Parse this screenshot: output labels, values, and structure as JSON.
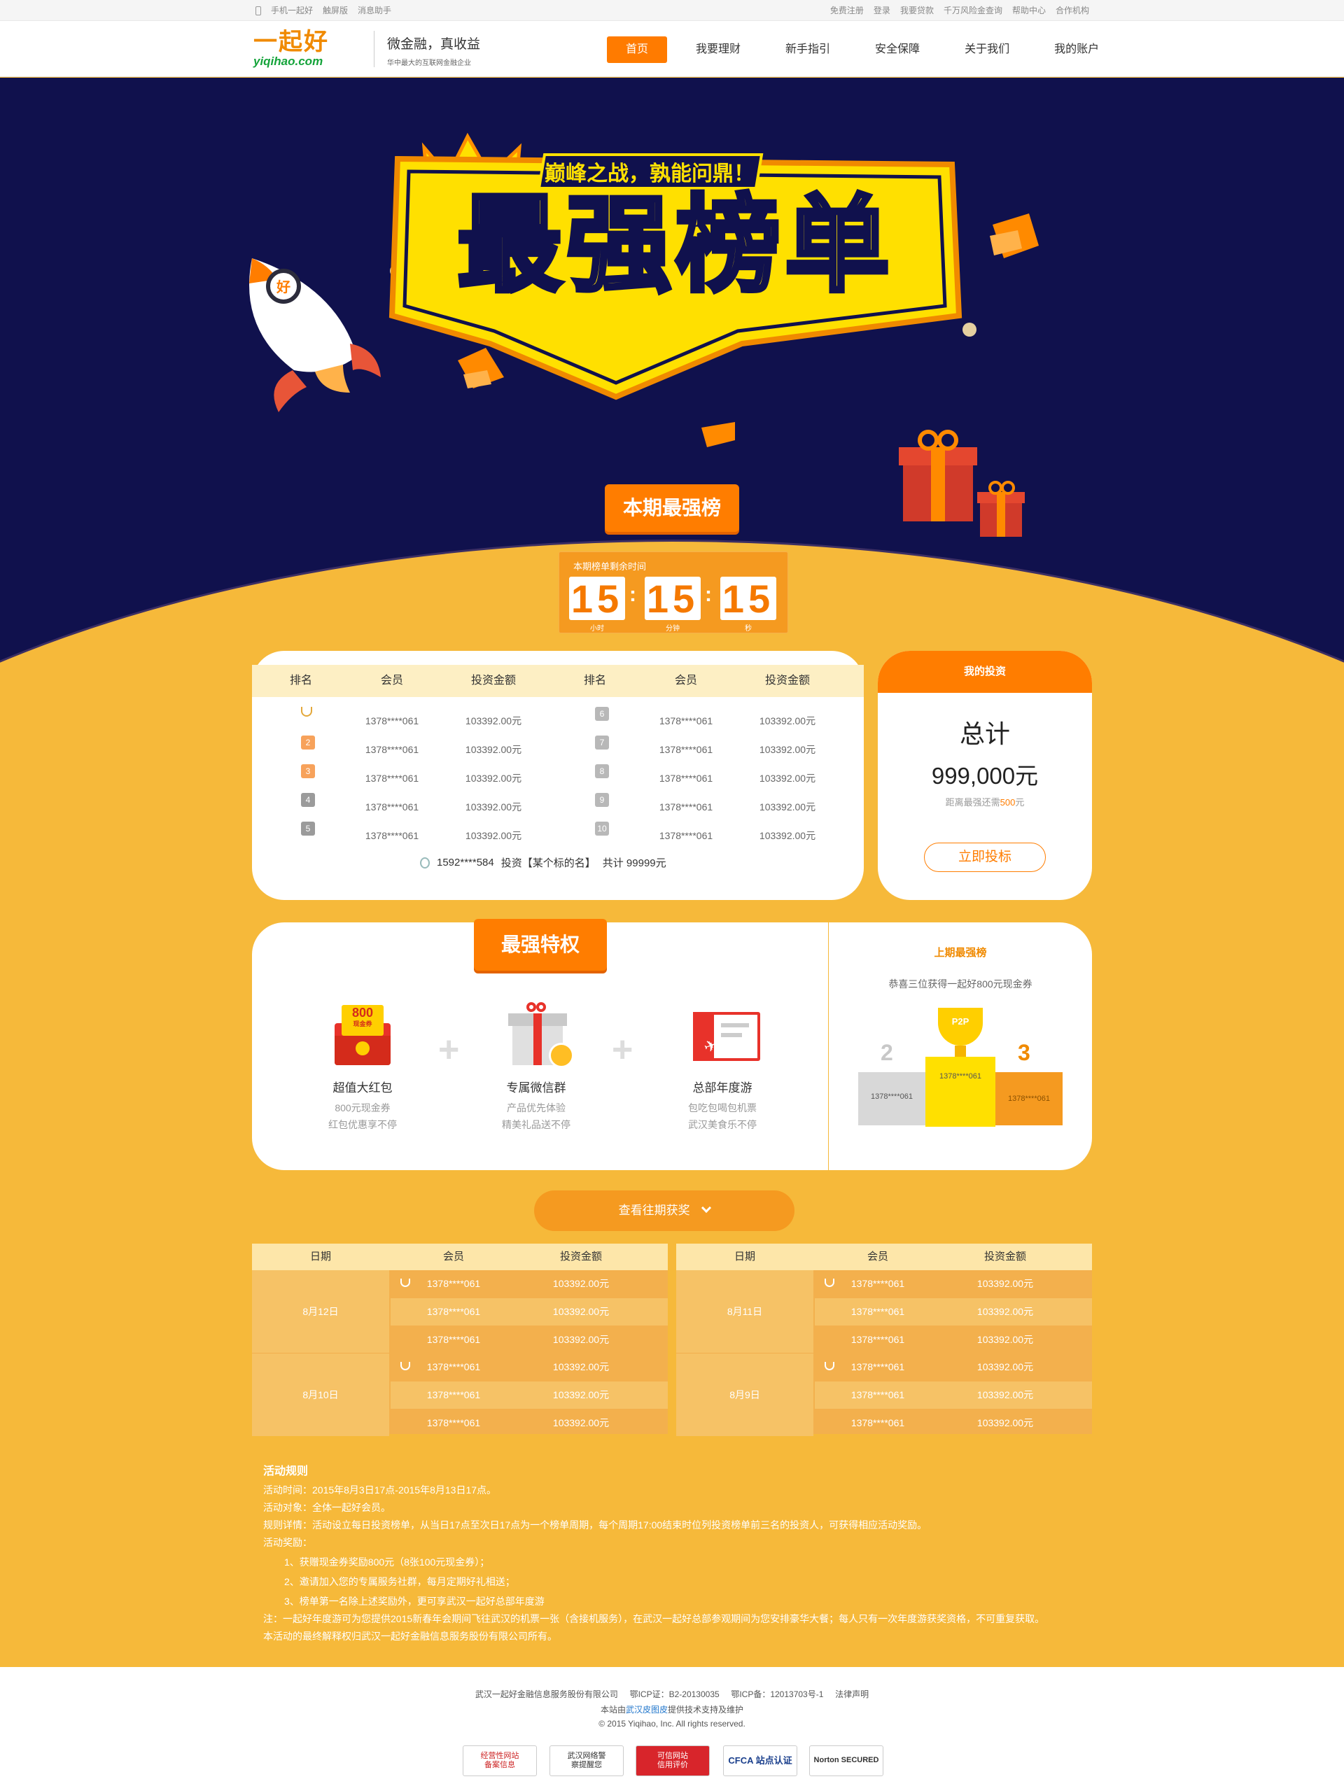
{
  "topbar": {
    "left": [
      "手机一起好",
      "触屏版",
      "消息助手"
    ],
    "right": [
      "免费注册",
      "登录",
      "我要贷款",
      "千万风险金查询",
      "帮助中心",
      "合作机构"
    ]
  },
  "header": {
    "logo_cn": "一起好",
    "logo_en": "yiqihao.com",
    "slogan1": "微金融，真收益",
    "slogan2": "华中最大的互联网金融企业",
    "nav": [
      "首页",
      "我要理财",
      "新手指引",
      "安全保障",
      "关于我们",
      "我的账户"
    ]
  },
  "hero": {
    "tagline": "巅峰之战，孰能问鼎！",
    "title": "最强榜单",
    "rocket_badge": "好"
  },
  "period": {
    "tab": "本期最强榜",
    "countdown_label": "本期榜单剩余时间",
    "hours": "15",
    "minutes": "15",
    "seconds": "15",
    "unit_h": "小时",
    "unit_m": "分钟",
    "unit_s": "秒"
  },
  "ranking": {
    "headers": [
      "排名",
      "会员",
      "投资金额",
      "排名",
      "会员",
      "投资金额"
    ],
    "left": [
      {
        "rank": "1",
        "member": "1378****061",
        "amount": "103392.00元"
      },
      {
        "rank": "2",
        "member": "1378****061",
        "amount": "103392.00元"
      },
      {
        "rank": "3",
        "member": "1378****061",
        "amount": "103392.00元"
      },
      {
        "rank": "4",
        "member": "1378****061",
        "amount": "103392.00元"
      },
      {
        "rank": "5",
        "member": "1378****061",
        "amount": "103392.00元"
      }
    ],
    "right": [
      {
        "rank": "6",
        "member": "1378****061",
        "amount": "103392.00元"
      },
      {
        "rank": "7",
        "member": "1378****061",
        "amount": "103392.00元"
      },
      {
        "rank": "8",
        "member": "1378****061",
        "amount": "103392.00元"
      },
      {
        "rank": "9",
        "member": "1378****061",
        "amount": "103392.00元"
      },
      {
        "rank": "10",
        "member": "1378****061",
        "amount": "103392.00元"
      }
    ],
    "my_member": "1592****584",
    "my_invest": "投资【某个标的名】",
    "my_total": "共计  99999元"
  },
  "my_investment": {
    "header": "我的投资",
    "total_label": "总计",
    "amount": "999,000元",
    "gap_prefix": "距离最强还需",
    "gap_value": "500",
    "gap_suffix": "元",
    "button": "立即投标"
  },
  "privileges": {
    "tab": "最强特权",
    "items": [
      {
        "title": "超值大红包",
        "line1": "800元现金券",
        "line2": "红包优惠享不停",
        "badge": "800",
        "badge_sub": "现金券"
      },
      {
        "title": "专属微信群",
        "line1": "产品优先体验",
        "line2": "精美礼品送不停"
      },
      {
        "title": "总部年度游",
        "line1": "包吃包喝包机票",
        "line2": "武汉美食乐不停"
      }
    ],
    "plus": "+"
  },
  "last_period": {
    "title": "上期最强榜",
    "subtitle": "恭喜三位获得一起好800元现金券",
    "second": "1378****061",
    "first": "1378****061",
    "third": "1378****061",
    "num2": "2",
    "num3": "3",
    "trophy_text": "P2P"
  },
  "history": {
    "button": "查看往期获奖",
    "headers": [
      "日期",
      "会员",
      "投资金额"
    ],
    "left": [
      {
        "date": "8月12日",
        "rows": [
          [
            "1378****061",
            "103392.00元"
          ],
          [
            "1378****061",
            "103392.00元"
          ],
          [
            "1378****061",
            "103392.00元"
          ]
        ]
      },
      {
        "date": "8月10日",
        "rows": [
          [
            "1378****061",
            "103392.00元"
          ],
          [
            "1378****061",
            "103392.00元"
          ],
          [
            "1378****061",
            "103392.00元"
          ]
        ]
      }
    ],
    "right": [
      {
        "date": "8月11日",
        "rows": [
          [
            "1378****061",
            "103392.00元"
          ],
          [
            "1378****061",
            "103392.00元"
          ],
          [
            "1378****061",
            "103392.00元"
          ]
        ]
      },
      {
        "date": "8月9日",
        "rows": [
          [
            "1378****061",
            "103392.00元"
          ],
          [
            "1378****061",
            "103392.00元"
          ],
          [
            "1378****061",
            "103392.00元"
          ]
        ]
      }
    ]
  },
  "rules": {
    "title": "活动规则",
    "lines": [
      "活动时间：2015年8月3日17点-2015年8月13日17点。",
      "活动对象：全体一起好会员。",
      "规则详情：活动设立每日投资榜单，从当日17点至次日17点为一个榜单周期，每个周期17:00结束时位列投资榜单前三名的投资人，可获得相应活动奖励。",
      "活动奖励："
    ],
    "rewards": [
      "1、获赠现金券奖励800元（8张100元现金券）；",
      "2、邀请加入您的专属服务社群，每月定期好礼相送；",
      "3、榜单第一名除上述奖励外，更可享武汉一起好总部年度游"
    ],
    "notes": [
      "注：一起好年度游可为您提供2015新春年会期间飞往武汉的机票一张（含接机服务），在武汉一起好总部参观期间为您安排豪华大餐；每人只有一次年度游获奖资格，不可重复获取。",
      "本活动的最终解释权归武汉一起好金融信息服务股份有限公司所有。"
    ]
  },
  "footer": {
    "line1": "武汉一起好金融信息服务股份有限公司     鄂ICP证：B2-20130035     鄂ICP备：12013703号-1     法律声明",
    "line2_prefix": "本站由",
    "line2_link": "武汉皮图皮",
    "line2_suffix": "提供技术支持及维护",
    "line3": "© 2015 Yiqihao, Inc. All rights reserved.",
    "certs": [
      "经营性网站\n备案信息",
      "武汉网络警\n察提醒您",
      "可信网站\n信用评价",
      "CFCA 站点认证",
      "Norton SECURED"
    ]
  },
  "colors": {
    "brand_orange": "#ff7d00",
    "page_yellow": "#f6b93a",
    "hero_navy": "#10114d",
    "title_yellow": "#ffe000"
  }
}
